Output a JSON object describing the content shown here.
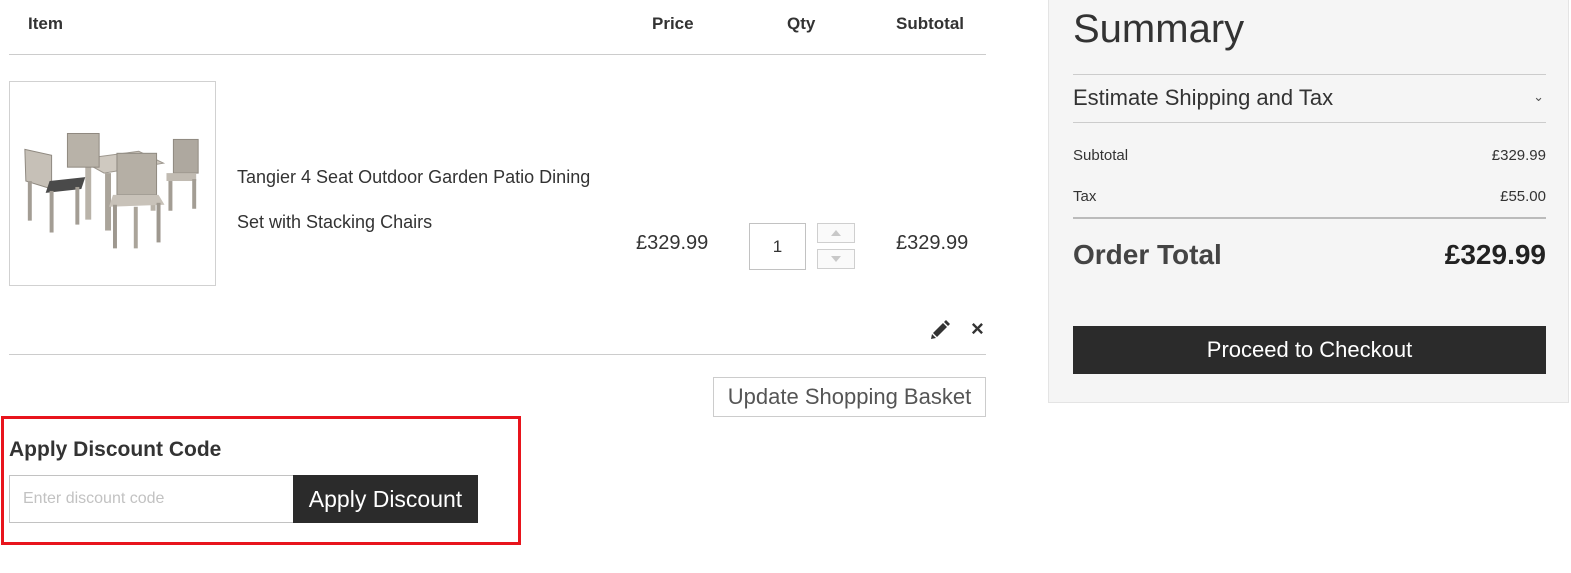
{
  "cart": {
    "headers": {
      "item": "Item",
      "price": "Price",
      "qty": "Qty",
      "subtotal": "Subtotal"
    },
    "items": [
      {
        "name": "Tangier 4 Seat Outdoor Garden Patio Dining Set with Stacking Chairs",
        "price": "£329.99",
        "qty": "1",
        "subtotal": "£329.99",
        "image_icon": "patio-dining-set-image"
      }
    ],
    "update_label": "Update Shopping Basket"
  },
  "discount": {
    "title": "Apply Discount Code",
    "placeholder": "Enter discount code",
    "value": "",
    "button_label": "Apply Discount",
    "highlight_color": "#e8141c"
  },
  "summary": {
    "title": "Summary",
    "estimate_label": "Estimate Shipping and Tax",
    "subtotal_label": "Subtotal",
    "subtotal_value": "£329.99",
    "tax_label": "Tax",
    "tax_value": "£55.00",
    "order_total_label": "Order Total",
    "order_total_value": "£329.99",
    "checkout_label": "Proceed to Checkout"
  },
  "colors": {
    "primary_button": "#2b2b2b",
    "summary_bg": "#f5f5f5"
  }
}
